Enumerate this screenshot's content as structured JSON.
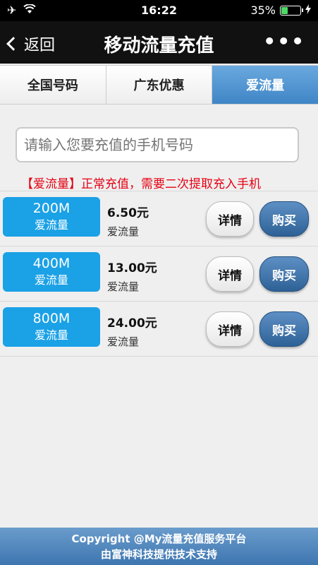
{
  "status": {
    "time": "16:22",
    "battery_percent": "35%",
    "battery_level": 0.35,
    "battery_color": "#4cd964"
  },
  "nav": {
    "back_label": "返回",
    "title": "移动流量充值",
    "more_label": "•••"
  },
  "tabs": [
    {
      "label": "全国号码",
      "active": false
    },
    {
      "label": "广东优惠",
      "active": false
    },
    {
      "label": "爱流量",
      "active": true
    }
  ],
  "phone_input": {
    "placeholder": "请输入您要充值的手机号码",
    "value": ""
  },
  "notice": "【爱流量】正常充值，需要二次提取充入手机",
  "products": [
    {
      "size": "200M",
      "type": "爱流量",
      "price": "6.50元",
      "desc": "爱流量",
      "detail_label": "详情",
      "buy_label": "购买"
    },
    {
      "size": "400M",
      "type": "爱流量",
      "price": "13.00元",
      "desc": "爱流量",
      "detail_label": "详情",
      "buy_label": "购买"
    },
    {
      "size": "800M",
      "type": "爱流量",
      "price": "24.00元",
      "desc": "爱流量",
      "detail_label": "详情",
      "buy_label": "购买"
    }
  ],
  "footer": {
    "line1": "Copyright @My流量充值服务平台",
    "line2": "由富神科技提供技术支持"
  },
  "colors": {
    "badge": "#1aa1e6",
    "active_tab": "#4a90d2",
    "buy_button": "#3a6fa6",
    "notice": "#e60012",
    "footer": "#4f86bd"
  }
}
